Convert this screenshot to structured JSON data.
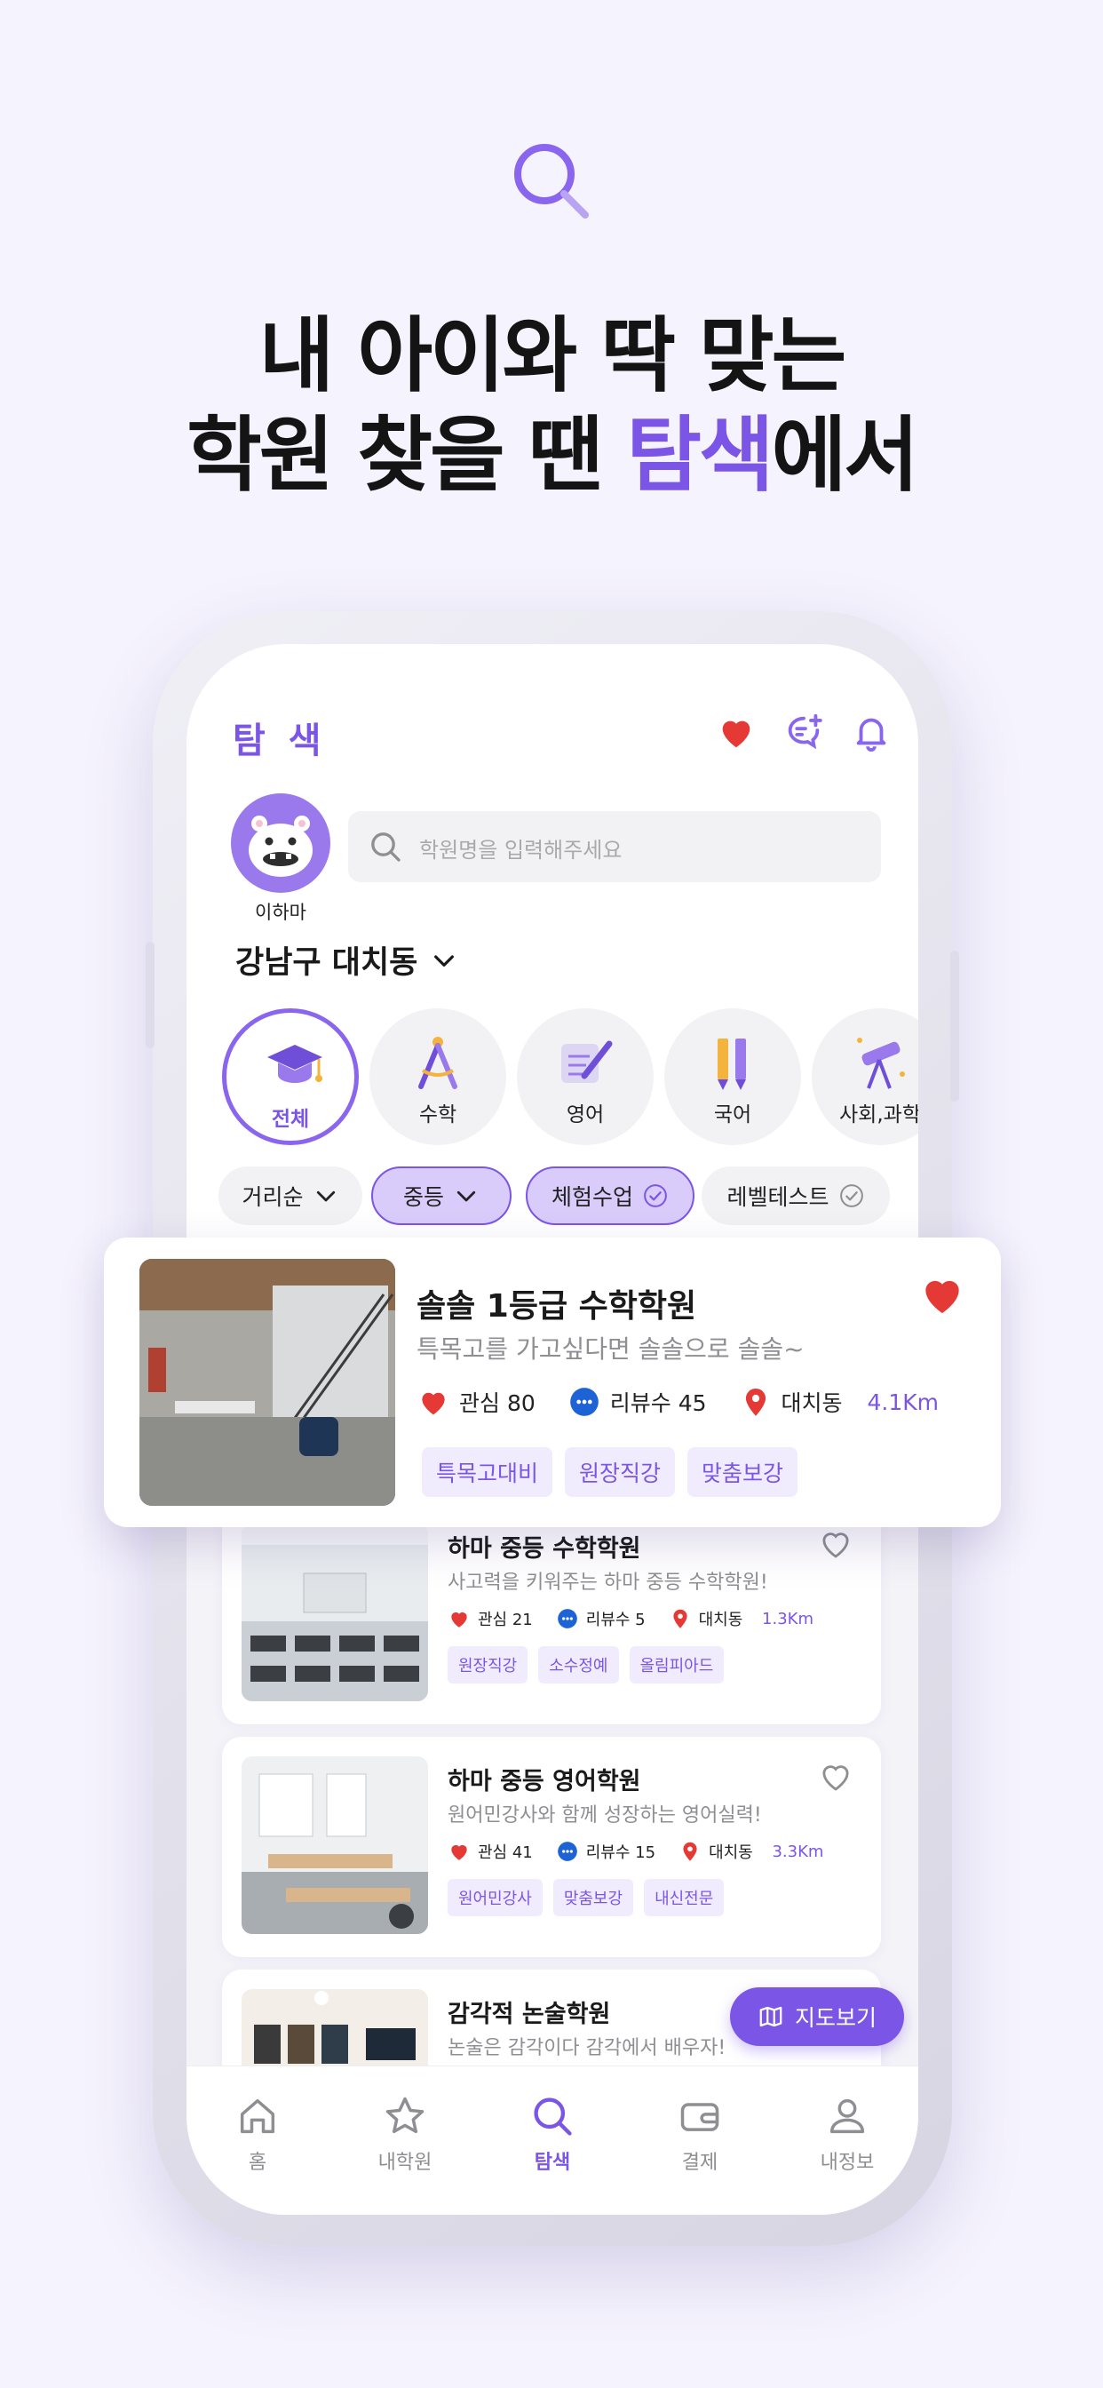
{
  "hero": {
    "line1": "내 아이와 딱 맞는",
    "line2_prefix": "학원 찾을 땐 ",
    "line2_highlight": "탐색",
    "line2_suffix": "에서",
    "icon": "search-icon"
  },
  "header": {
    "title": "탐 색",
    "icons": [
      "heart-icon",
      "chat-add-icon",
      "bell-icon"
    ]
  },
  "profile": {
    "name": "이하마",
    "avatar": "hippo-mascot"
  },
  "search": {
    "placeholder": "학원명을 입력해주세요"
  },
  "location": {
    "label": "강남구 대치동"
  },
  "categories": [
    {
      "label": "전체",
      "icon": "graduation-cap-icon",
      "active": true
    },
    {
      "label": "수학",
      "icon": "compass-icon",
      "active": false
    },
    {
      "label": "영어",
      "icon": "scroll-pen-icon",
      "active": false
    },
    {
      "label": "국어",
      "icon": "pencil-icon",
      "active": false
    },
    {
      "label": "사회,과학",
      "icon": "telescope-icon",
      "active": false
    }
  ],
  "filters": [
    {
      "label": "거리순",
      "type": "dropdown",
      "selected": false
    },
    {
      "label": "중등",
      "type": "dropdown",
      "selected": true
    },
    {
      "label": "체험수업",
      "type": "check",
      "selected": true
    },
    {
      "label": "레벨테스트",
      "type": "check",
      "selected": false
    }
  ],
  "featured": {
    "name": "솔솔 1등급 수학학원",
    "desc": "특목고를 가고싶다면 솔솔으로 솔솔~",
    "likes": "관심 80",
    "reviews": "리뷰수 45",
    "area": "대치동",
    "distance": "4.1Km",
    "tags": [
      "특목고대비",
      "원장직강",
      "맞춤보강"
    ],
    "favorited": true
  },
  "academies": [
    {
      "name": "하마 중등 수학학원",
      "desc": "사고력을 키워주는 하마 중등 수학학원!",
      "likes": "관심 21",
      "reviews": "리뷰수 5",
      "area": "대치동",
      "distance": "1.3Km",
      "tags": [
        "원장직강",
        "소수정예",
        "올림피아드"
      ],
      "favorited": false
    },
    {
      "name": "하마 중등 영어학원",
      "desc": "원어민강사와 함께 성장하는 영어실력!",
      "likes": "관심 41",
      "reviews": "리뷰수 15",
      "area": "대치동",
      "distance": "3.3Km",
      "tags": [
        "원어민강사",
        "맞춤보강",
        "내신전문"
      ],
      "favorited": false
    },
    {
      "name": "감각적 논술학원",
      "desc": "논술은 감각이다 감각에서 배우자!",
      "favorited": true
    }
  ],
  "map_button": {
    "label": "지도보기"
  },
  "tabbar": [
    {
      "label": "홈",
      "icon": "home-icon",
      "active": false
    },
    {
      "label": "내학원",
      "icon": "star-icon",
      "active": false
    },
    {
      "label": "탐색",
      "icon": "search-icon",
      "active": true
    },
    {
      "label": "결제",
      "icon": "wallet-icon",
      "active": false
    },
    {
      "label": "내정보",
      "icon": "person-icon",
      "active": false
    }
  ],
  "colors": {
    "accent": "#7b55e6",
    "accent_light": "#f1ecfd",
    "heart": "#e53935",
    "review": "#1e63d6",
    "background": "#f5f3fd"
  }
}
